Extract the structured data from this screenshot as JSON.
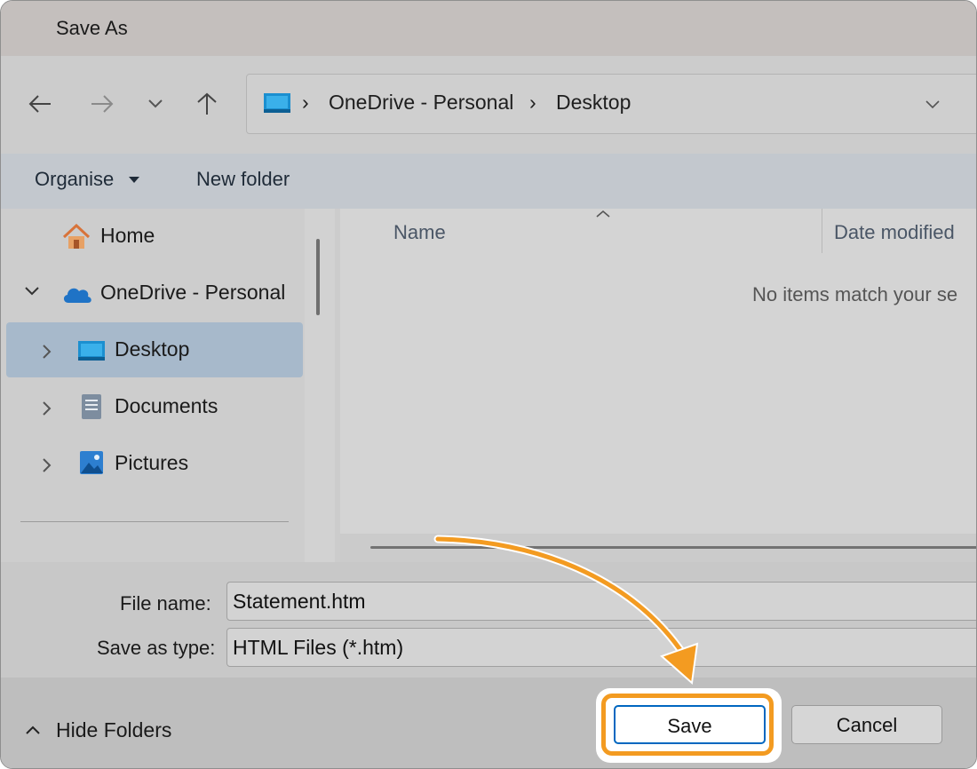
{
  "window": {
    "title": "Save As"
  },
  "navigation": {
    "back_icon": "arrow-left-icon",
    "forward_icon": "arrow-right-icon",
    "recent_icon": "chevron-down-icon",
    "up_icon": "arrow-up-icon"
  },
  "address_bar": {
    "segments": [
      "OneDrive - Personal",
      "Desktop"
    ],
    "dropdown_icon": "chevron-down-icon"
  },
  "toolbar": {
    "organise_label": "Organise",
    "new_folder_label": "New folder"
  },
  "sidebar": {
    "items": [
      {
        "label": "Home",
        "icon": "home-icon"
      },
      {
        "label": "OneDrive - Personal",
        "icon": "cloud-icon",
        "expanded": true
      },
      {
        "label": "Desktop",
        "icon": "desktop-folder-icon",
        "selected": true
      },
      {
        "label": "Documents",
        "icon": "documents-icon"
      },
      {
        "label": "Pictures",
        "icon": "pictures-icon"
      }
    ]
  },
  "file_list": {
    "columns": [
      "Name",
      "Date modified"
    ],
    "empty_message": "No items match your se"
  },
  "form": {
    "file_name_label": "File name:",
    "file_name_value": "Statement.htm",
    "save_type_label": "Save as type:",
    "save_type_value": "HTML Files (*.htm)"
  },
  "footer": {
    "hide_folders_label": "Hide Folders",
    "save_label": "Save",
    "cancel_label": "Cancel"
  },
  "colors": {
    "highlight": "#f39b21",
    "save_border": "#0067c0",
    "selected_row": "#a7b9cb"
  }
}
